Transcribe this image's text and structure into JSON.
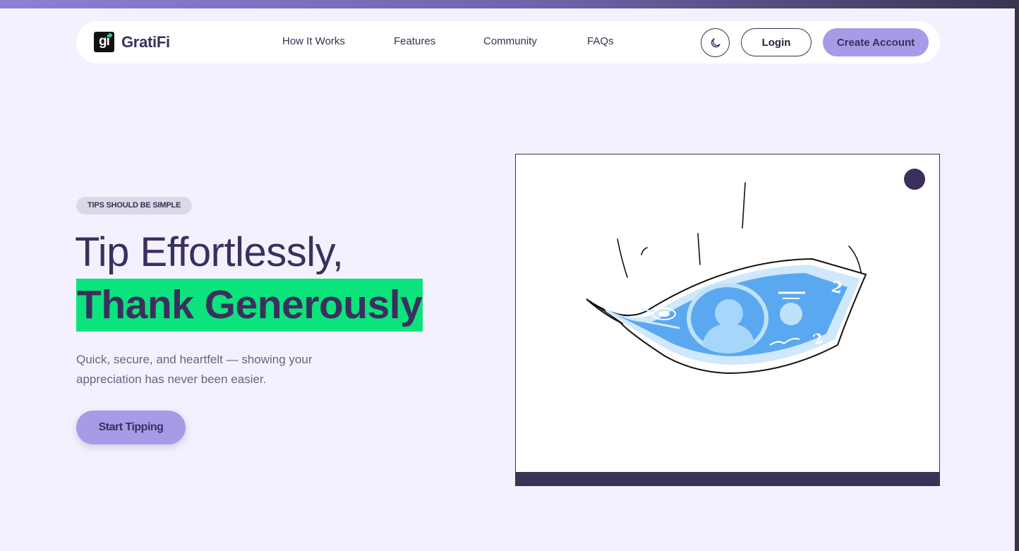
{
  "app": {
    "logo_mark": "gi",
    "logo_text": "GratiFi",
    "brand_colors": {
      "primary": "#a79be8",
      "accent": "#0be37d",
      "text": "#3c2f5e",
      "background": "#f3f1fd"
    }
  },
  "nav": {
    "links": [
      {
        "label": "How It Works"
      },
      {
        "label": "Features"
      },
      {
        "label": "Community"
      },
      {
        "label": "FAQs"
      }
    ],
    "theme_icon": "moon-icon",
    "login_label": "Login",
    "create_label": "Create Account"
  },
  "hero": {
    "badge": "TIPS SHOULD BE SIMPLE",
    "title_line1": "Tip Effortlessly,",
    "title_line2": "Thank Generously",
    "subtitle": "Quick, secure, and heartfelt — showing your appreciation has never been easier.",
    "cta_label": "Start Tipping"
  },
  "illustration": {
    "subject": "money-bill-icon"
  }
}
